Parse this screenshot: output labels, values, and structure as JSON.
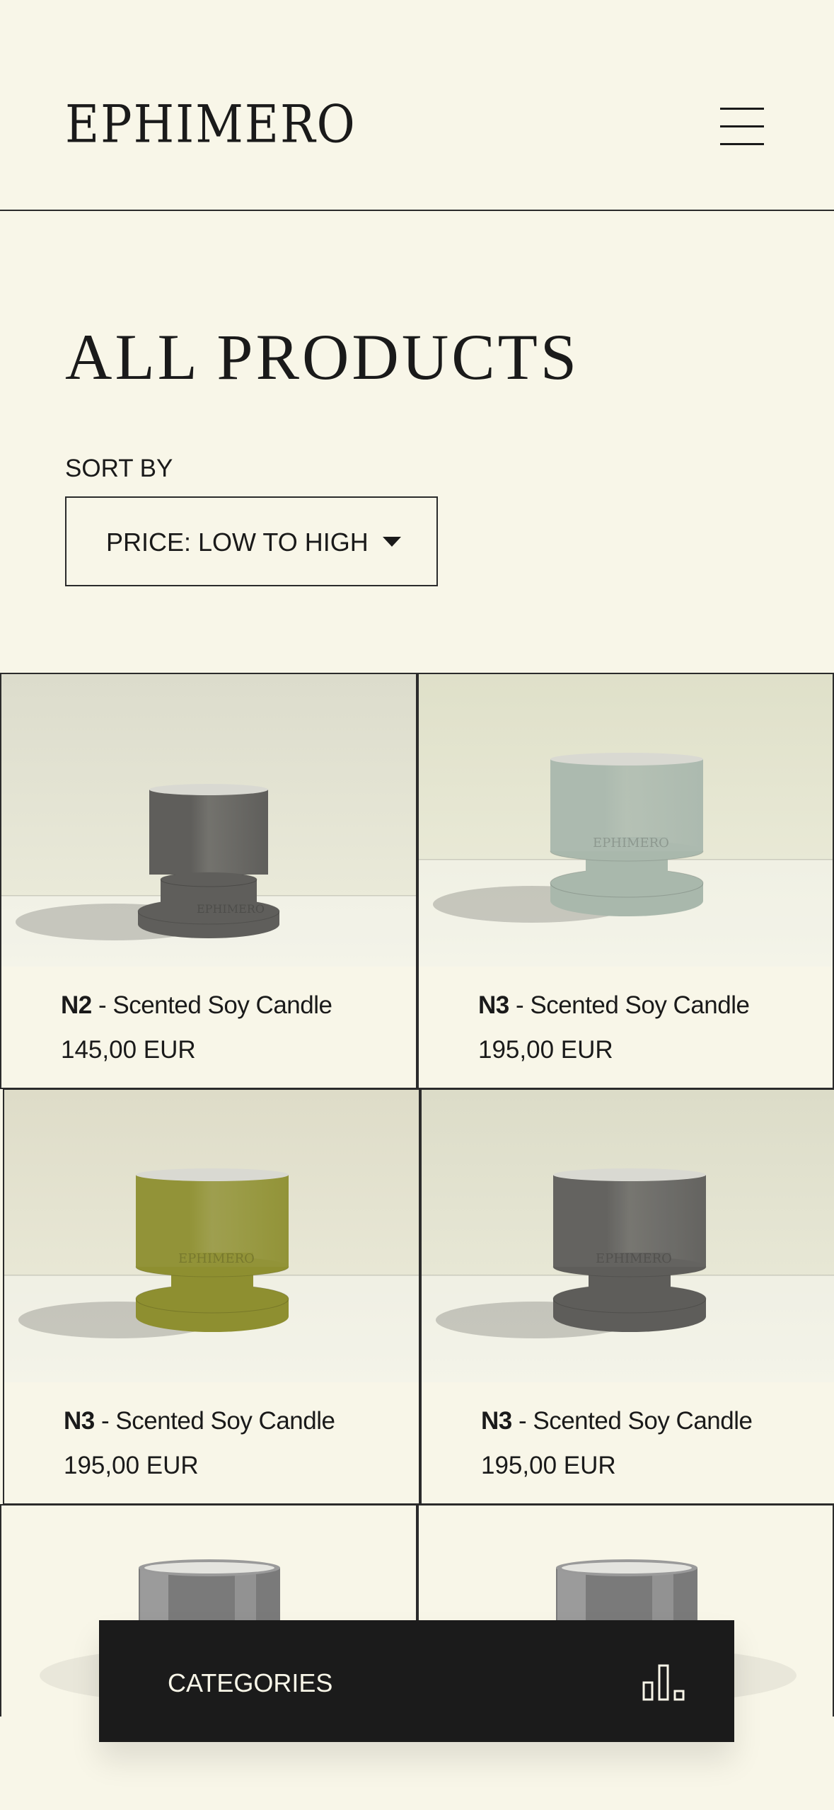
{
  "header": {
    "logo": "EPHIMERO",
    "menu_icon": "hamburger-menu-icon"
  },
  "page": {
    "title": "ALL PRODUCTS",
    "sort_label": "SORT BY",
    "sort_value": "PRICE: LOW TO HIGH",
    "sort_icon": "caret-down-icon"
  },
  "products": [
    {
      "number": "N2",
      "name": "Scented Soy Candle",
      "price": "145,00 EUR",
      "color": "#5f5e5b",
      "bg": "#dcdccc",
      "brand_mark": "EPHIMERO"
    },
    {
      "number": "N3",
      "name": "Scented Soy Candle",
      "price": "195,00 EUR",
      "color": "#a9b8ac",
      "bg": "#dfe0c9",
      "brand_mark": "EPHIMERO"
    },
    {
      "number": "N3",
      "name": "Scented Soy Candle",
      "price": "195,00 EUR",
      "color": "#8e8f30",
      "bg": "#dedcc8",
      "brand_mark": "EPHIMERO"
    },
    {
      "number": "N3",
      "name": "Scented Soy Candle",
      "price": "195,00 EUR",
      "color": "#5e5d5a",
      "bg": "#dcdcc8",
      "brand_mark": "EPHIMERO"
    },
    {
      "number": "",
      "name": "",
      "price": "",
      "color": "#6b6b6b",
      "bg": "#f8f6e8"
    },
    {
      "number": "",
      "name": "",
      "price": "",
      "color": "#6b6b6b",
      "bg": "#f8f6e8"
    }
  ],
  "categories_bar": {
    "label": "CATEGORIES",
    "icon": "bar-chart-icon"
  }
}
